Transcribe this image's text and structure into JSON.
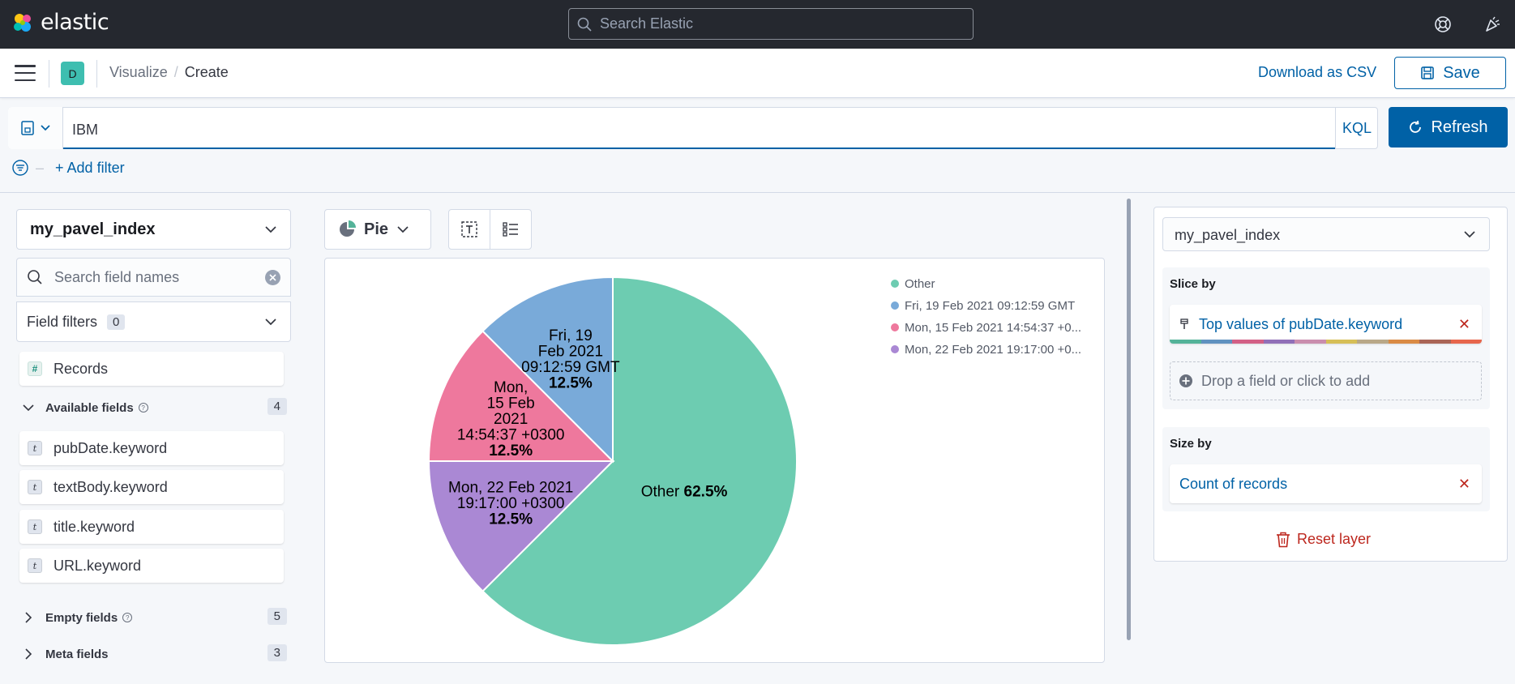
{
  "header": {
    "logo_text": "elastic",
    "search_placeholder": "Search Elastic",
    "icons": [
      "help-lifebuoy-icon",
      "newsfeed-icon"
    ]
  },
  "app_bar": {
    "space_initial": "D",
    "breadcrumbs": [
      "Visualize",
      "Create"
    ],
    "download_csv": "Download as CSV",
    "save": "Save"
  },
  "query_bar": {
    "query": "IBM",
    "language": "KQL",
    "refresh": "Refresh",
    "add_filter": "+ Add filter"
  },
  "left_panel": {
    "index_pattern": "my_pavel_index",
    "search_placeholder": "Search field names",
    "field_filters_label": "Field filters",
    "field_filters_count": "0",
    "records_label": "Records",
    "available": {
      "label": "Available fields",
      "count": "4"
    },
    "fields": [
      "pubDate.keyword",
      "textBody.keyword",
      "title.keyword",
      "URL.keyword"
    ],
    "empty": {
      "label": "Empty fields",
      "count": "5"
    },
    "meta": {
      "label": "Meta fields",
      "count": "3"
    }
  },
  "workspace": {
    "chart_type": "Pie"
  },
  "chart_data": {
    "type": "pie",
    "slices": [
      {
        "label": "Other",
        "value": 62.5,
        "color": "#6dccb1",
        "label_lines": [
          "Other"
        ],
        "pct": "62.5%"
      },
      {
        "label": "Mon, 22 Feb 2021 19:17:00 +0...",
        "value": 12.5,
        "color": "#aa88d4",
        "label_lines": [
          "Mon, 22 Feb 2021",
          "19:17:00 +0300"
        ],
        "pct": "12.5%"
      },
      {
        "label": "Mon, 15 Feb 2021 14:54:37 +0...",
        "value": 12.5,
        "color": "#ee789d",
        "label_lines": [
          "Mon,",
          "15 Feb",
          "2021",
          "14:54:37 +0300"
        ],
        "pct": "12.5%"
      },
      {
        "label": "Fri, 19 Feb 2021 09:12:59 GMT",
        "value": 12.5,
        "color": "#79aad9",
        "label_lines": [
          "Fri, 19",
          "Feb 2021",
          "09:12:59 GMT"
        ],
        "pct": "12.5%"
      }
    ],
    "legend": [
      {
        "label": "Other",
        "color": "#6dccb1"
      },
      {
        "label": "Fri, 19 Feb 2021 09:12:59 GMT",
        "color": "#79aad9"
      },
      {
        "label": "Mon, 15 Feb 2021 14:54:37 +0...",
        "color": "#ee789d"
      },
      {
        "label": "Mon, 22 Feb 2021 19:17:00 +0...",
        "color": "#aa88d4"
      }
    ],
    "legend_position": "top-right"
  },
  "right_panel": {
    "index_pattern": "my_pavel_index",
    "slice_by": {
      "title": "Slice by",
      "dimension": "Top values of pubDate.keyword"
    },
    "drop_zone": "Drop a field or click to add",
    "size_by": {
      "title": "Size by",
      "dimension": "Count of records"
    },
    "reset": "Reset layer"
  },
  "colors": {
    "accent": "#0061a6",
    "danger": "#bd271e",
    "topbar": "#25282f",
    "palette": [
      "#54b399",
      "#6092c0",
      "#d36086",
      "#9170b8",
      "#ca8eae",
      "#d6bf57",
      "#b9a888",
      "#da8b45",
      "#aa6556",
      "#e7664c"
    ]
  }
}
